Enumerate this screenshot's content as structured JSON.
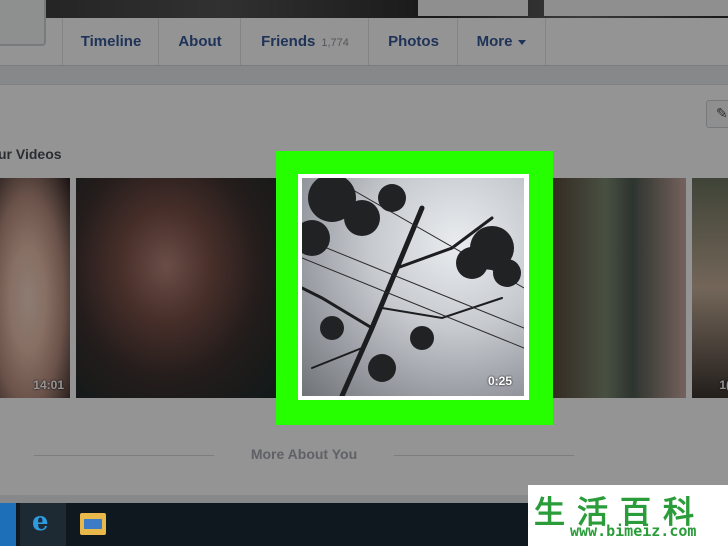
{
  "nav": {
    "tabs": [
      {
        "label": "Timeline"
      },
      {
        "label": "About"
      },
      {
        "label": "Friends",
        "count": "1,774"
      },
      {
        "label": "Photos"
      },
      {
        "label": "More"
      }
    ]
  },
  "videos": {
    "section_title": "ur Videos",
    "items": [
      {
        "duration": "14:01"
      },
      {
        "duration": ""
      },
      {
        "duration": "0:25",
        "selected": true
      },
      {
        "duration": ""
      },
      {
        "duration": "1("
      }
    ]
  },
  "more_about": "More About You",
  "watermark": {
    "text": "生活百科",
    "url": "www.bimeiz.com"
  },
  "colors": {
    "highlight": "#26ff00",
    "link": "#365899",
    "watermark": "#2a9d3a"
  },
  "icons": [
    "pencil-icon",
    "caret-down-icon",
    "edge-icon",
    "file-explorer-icon"
  ]
}
